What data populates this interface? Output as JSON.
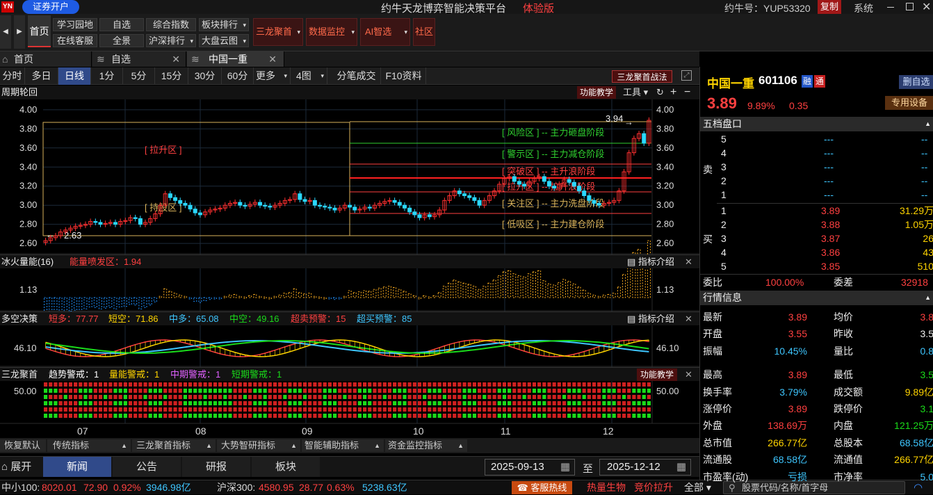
{
  "title_bar": {
    "open_account": "证券开户",
    "app_title": "约牛天龙博弈智能决策平台",
    "edition": "体验版",
    "account": "约牛号：YUP53320",
    "copy": "复制",
    "system": "系统"
  },
  "toolbar": {
    "home": "首页",
    "row1": [
      "学习园地",
      "自选",
      "综合指数",
      "板块排行"
    ],
    "row2": [
      "在线客服",
      "全景",
      "沪深排行",
      "大盘云图"
    ],
    "red_buttons": [
      "三龙聚首",
      "数据监控",
      "AI智选",
      "社区"
    ]
  },
  "tabs": [
    "首页",
    "自选",
    "中国一重"
  ],
  "periods": [
    "分时",
    "多日",
    "日线",
    "1分",
    "5分",
    "15分",
    "30分",
    "60分",
    "更多",
    "4图",
    "分笔成交",
    "F10资料"
  ],
  "strategy_btn": "三龙聚首战法",
  "main_chart": {
    "panel_title": "周期轮回",
    "teach_btn": "功能教学",
    "tools": "工具",
    "y_ticks": [
      "4.00",
      "3.80",
      "3.60",
      "3.40",
      "3.20",
      "3.00",
      "2.80",
      "2.60"
    ],
    "max_label": "3.94",
    "min_label": "2.63",
    "zone_left_up": "[ 拉升区 ]",
    "zone_left_hold": "[ 持股区 ]",
    "zones": [
      "[ 风险区 ] -- 主力砸盘阶段",
      "[ 警示区 ] -- 主力减仓阶段",
      "[ 突破区 ] -- 主升浪阶段",
      "[ 拉升区 ] -- 拉升浪阶段",
      "[ 关注区 ] -- 主力洗盘阶段",
      "[ 低吸区 ] -- 主力建仓阶段"
    ]
  },
  "panel2": {
    "title": "冰火量能(16)",
    "label": "能量喷发区：1.94",
    "intro": "指标介绍",
    "value": "1.13"
  },
  "panel3": {
    "title": "多空决策",
    "items": [
      {
        "text": "短多：77.77",
        "color": "#ff4040"
      },
      {
        "text": "短空：71.86",
        "color": "#ffd400"
      },
      {
        "text": "中多：65.08",
        "color": "#3ec6ff"
      },
      {
        "text": "中空：49.16",
        "color": "#1adb1a"
      },
      {
        "text": "超卖预警：15",
        "color": "#ff4040"
      },
      {
        "text": "超买预警：85",
        "color": "#3ec6ff"
      }
    ],
    "intro": "指标介绍",
    "value": "46.10"
  },
  "panel4": {
    "title": "三龙聚首",
    "items": [
      {
        "text": "趋势警戒：1",
        "color": "#ffffff"
      },
      {
        "text": "量能警戒：1",
        "color": "#ffd400"
      },
      {
        "text": "中期警戒：1",
        "color": "#e060ff"
      },
      {
        "text": "短期警戒：1",
        "color": "#1adb1a"
      }
    ],
    "teach": "功能教学",
    "value": "50.00"
  },
  "x_axis": [
    "07",
    "08",
    "09",
    "10",
    "11",
    "12"
  ],
  "indicator_tabs": [
    "恢复默认",
    "传统指标",
    "三龙聚首指标",
    "大势智研指标",
    "智能辅助指标",
    "资金监控指标"
  ],
  "news": {
    "expand": "展开",
    "tabs": [
      "新闻",
      "公告",
      "研报",
      "板块"
    ],
    "date_from": "2025-09-13",
    "to": "至",
    "date_to": "2025-12-12"
  },
  "status": {
    "idx1_name": "中小100:",
    "idx1": "8020.01",
    "idx1_chg": "72.90",
    "idx1_pct": "0.92%",
    "idx1_amt": "3946.98亿",
    "idx2_name": "沪深300:",
    "idx2": "4580.95",
    "idx2_chg": "28.77",
    "idx2_pct": "0.63%",
    "idx2_amt": "5238.63亿",
    "hotline": "客服热线",
    "hot1": "热量生物",
    "hot2": "竞价拉升",
    "all": "全部",
    "search_placeholder": "股票代码/名称/首字母"
  },
  "stock": {
    "name": "中国一重",
    "code": "601106",
    "rong": "融",
    "tong": "通",
    "price": "3.89",
    "pct": "9.89%",
    "chg": "0.35",
    "del_fav": "删自选",
    "device": "专用设备"
  },
  "order_book": {
    "title": "五档盘口",
    "sell_label": "卖",
    "buy_label": "买",
    "sell": [
      {
        "lvl": "5",
        "price": "---",
        "vol": "--"
      },
      {
        "lvl": "4",
        "price": "---",
        "vol": "--"
      },
      {
        "lvl": "3",
        "price": "---",
        "vol": "--"
      },
      {
        "lvl": "2",
        "price": "---",
        "vol": "--"
      },
      {
        "lvl": "1",
        "price": "---",
        "vol": "--"
      }
    ],
    "buy": [
      {
        "lvl": "1",
        "price": "3.89",
        "vol": "31.29万"
      },
      {
        "lvl": "2",
        "price": "3.88",
        "vol": "1.05万"
      },
      {
        "lvl": "3",
        "price": "3.87",
        "vol": "26"
      },
      {
        "lvl": "4",
        "price": "3.86",
        "vol": "43"
      },
      {
        "lvl": "5",
        "price": "3.85",
        "vol": "510"
      }
    ],
    "weibi_label": "委比",
    "weibi": "100.00%",
    "weicha_label": "委差",
    "weicha": "32918"
  },
  "quote": {
    "title": "行情信息",
    "rows": [
      [
        {
          "k": "最新",
          "v": "3.89",
          "c": "red"
        },
        {
          "k": "均价",
          "v": "3.8",
          "c": "red"
        }
      ],
      [
        {
          "k": "开盘",
          "v": "3.55",
          "c": "red"
        },
        {
          "k": "昨收",
          "v": "3.5",
          "c": "wht"
        }
      ],
      [
        {
          "k": "振幅",
          "v": "10.45%",
          "c": "cyan"
        },
        {
          "k": "量比",
          "v": "0.8",
          "c": "cyan"
        }
      ],
      [
        {
          "k": "最高",
          "v": "3.89",
          "c": "red"
        },
        {
          "k": "最低",
          "v": "3.5",
          "c": "grn"
        }
      ],
      [
        {
          "k": "换手率",
          "v": "3.79%",
          "c": "cyan"
        },
        {
          "k": "成交额",
          "v": "9.89亿",
          "c": "yel"
        }
      ],
      [
        {
          "k": "涨停价",
          "v": "3.89",
          "c": "red"
        },
        {
          "k": "跌停价",
          "v": "3.1",
          "c": "grn"
        }
      ],
      [
        {
          "k": "外盘",
          "v": "138.69万",
          "c": "red"
        },
        {
          "k": "内盘",
          "v": "121.25万",
          "c": "grn"
        }
      ],
      [
        {
          "k": "总市值",
          "v": "266.77亿",
          "c": "yel"
        },
        {
          "k": "总股本",
          "v": "68.58亿",
          "c": "cyan"
        }
      ],
      [
        {
          "k": "流通股",
          "v": "68.58亿",
          "c": "cyan"
        },
        {
          "k": "流通值",
          "v": "266.77亿",
          "c": "yel"
        }
      ],
      [
        {
          "k": "市盈率(动)",
          "v": "亏损",
          "c": "cyan"
        },
        {
          "k": "市净率",
          "v": "5.0",
          "c": "cyan"
        }
      ]
    ]
  },
  "chart_data": {
    "type": "candlestick",
    "ylim": [
      2.55,
      4.05
    ],
    "closes": [
      2.63,
      2.66,
      2.68,
      2.72,
      2.74,
      2.76,
      2.78,
      2.79,
      2.8,
      2.83,
      2.82,
      2.8,
      2.81,
      2.82,
      2.8,
      2.83,
      2.84,
      2.87,
      2.86,
      2.8,
      2.82,
      2.86,
      2.91,
      3.0,
      3.12,
      3.08,
      3.05,
      3.02,
      3.0,
      2.96,
      2.92,
      2.9,
      2.93,
      2.95,
      2.96,
      2.97,
      3.0,
      3.02,
      3.03,
      3.0,
      2.99,
      3.01,
      3.03,
      3.0,
      2.99,
      2.98,
      3.0,
      3.02,
      3.05,
      3.06,
      3.12,
      3.06,
      3.04,
      3.05,
      3.0,
      2.99,
      2.98,
      2.97,
      2.95,
      2.97,
      3.0,
      2.98,
      2.95,
      2.96,
      2.98,
      2.97,
      3.0,
      3.02,
      3.04,
      3.05,
      3.03,
      3.0,
      2.97,
      2.93,
      2.9,
      2.87,
      2.9,
      2.88,
      2.9,
      2.95,
      3.05,
      3.1,
      3.15,
      3.12,
      3.1,
      3.08,
      3.05,
      3.0,
      3.05,
      3.1,
      3.15,
      3.22,
      3.28,
      3.3,
      3.25,
      3.22,
      3.2,
      3.25,
      3.28,
      3.3,
      3.25,
      3.2,
      3.18,
      3.22,
      3.27,
      3.24,
      3.2,
      3.15,
      3.1,
      3.05,
      3.02,
      3.0,
      3.02,
      3.03,
      3.05,
      3.15,
      3.35,
      3.55,
      3.7,
      3.75,
      3.65,
      3.89
    ]
  }
}
